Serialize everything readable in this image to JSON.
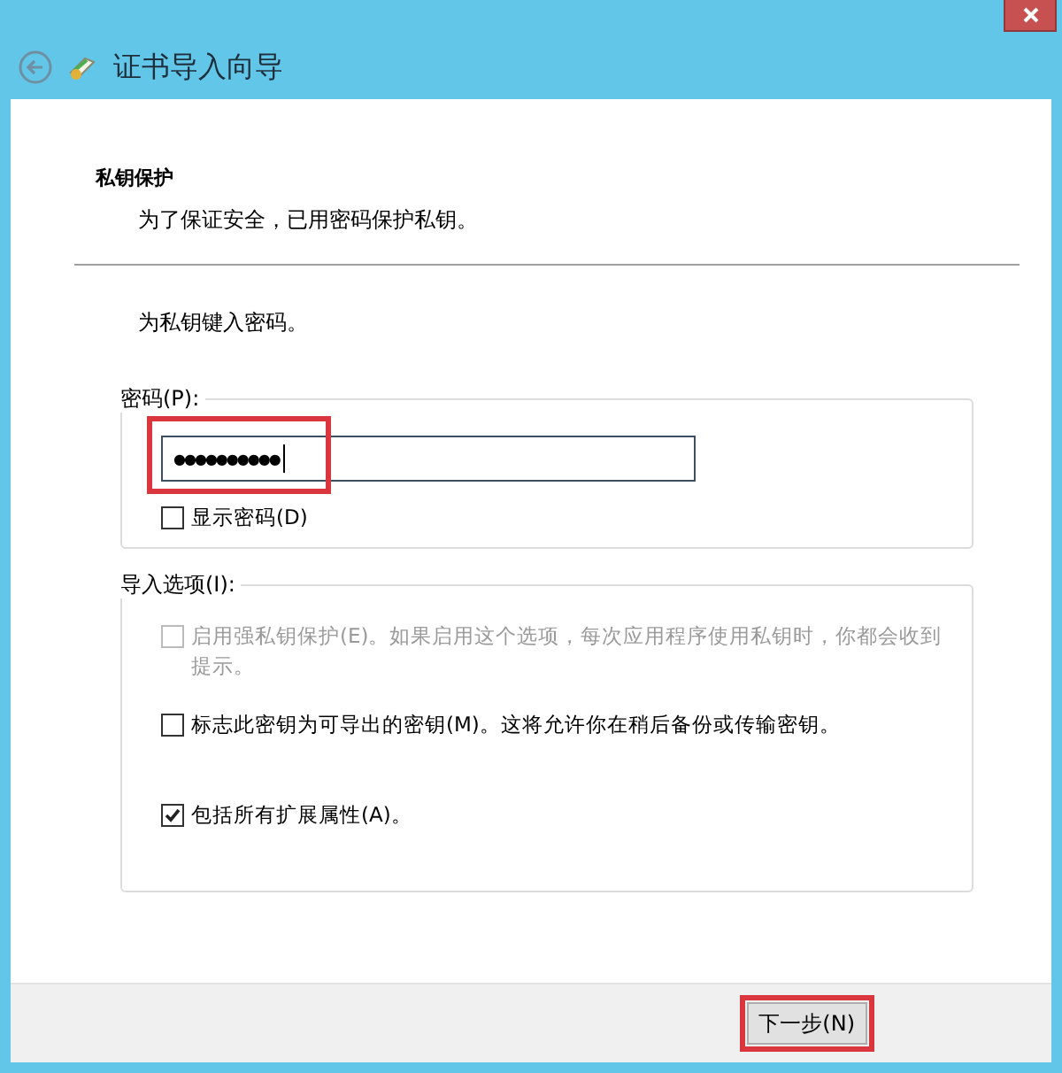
{
  "window": {
    "title": "证书导入向导"
  },
  "page": {
    "heading": "私钥保护",
    "subtitle": "为了保证安全，已用密码保护私钥。",
    "instruction": "为私钥键入密码。"
  },
  "password_group": {
    "label": "密码(P):",
    "value": "●●●●●●●●●●",
    "highlighted": true,
    "show_password": {
      "label": "显示密码(D)",
      "checked": false
    }
  },
  "options_group": {
    "label": "导入选项(I):",
    "options": [
      {
        "label": "启用强私钥保护(E)。如果启用这个选项，每次应用程序使用私钥时，你都会收到提示。",
        "checked": false,
        "disabled": true
      },
      {
        "label": "标志此密钥为可导出的密钥(M)。这将允许你在稍后备份或传输密钥。",
        "checked": false,
        "disabled": false
      },
      {
        "label": "包括所有扩展属性(A)。",
        "checked": true,
        "disabled": false
      }
    ]
  },
  "buttons": [
    {
      "label": "下一步(N)",
      "highlighted": true
    }
  ]
}
